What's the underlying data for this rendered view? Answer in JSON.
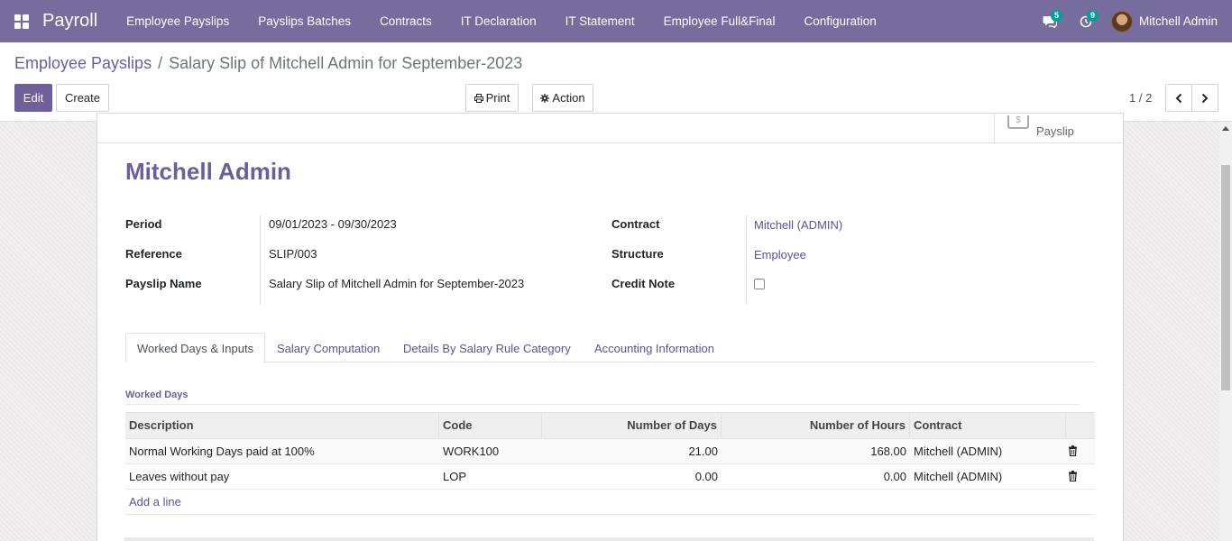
{
  "app": {
    "name": "Payroll",
    "menu": [
      "Employee Payslips",
      "Payslips Batches",
      "Contracts",
      "IT Declaration",
      "IT Statement",
      "Employee Full&Final",
      "Configuration"
    ],
    "messages_count": "5",
    "activities_count": "9",
    "user_name": "Mitchell Admin"
  },
  "breadcrumb": {
    "parent": "Employee Payslips",
    "separator": "/",
    "current": "Salary Slip of Mitchell Admin for September-2023"
  },
  "toolbar": {
    "edit_label": "Edit",
    "create_label": "Create",
    "print_label": "Print",
    "action_label": "Action",
    "pager": "1 / 2"
  },
  "form": {
    "smart_button_label": "Payslip",
    "employee_name": "Mitchell Admin",
    "fields_left": [
      {
        "label": "Period",
        "value": "09/01/2023 - 09/30/2023"
      },
      {
        "label": "Reference",
        "value": "SLIP/003"
      },
      {
        "label": "Payslip Name",
        "value": "Salary Slip of Mitchell Admin for September-2023"
      }
    ],
    "fields_right": [
      {
        "label": "Contract",
        "value": "Mitchell (ADMIN)"
      },
      {
        "label": "Structure",
        "value": "Employee"
      },
      {
        "label": "Credit Note",
        "value": ""
      }
    ]
  },
  "tabs": [
    "Worked Days & Inputs",
    "Salary Computation",
    "Details By Salary Rule Category",
    "Accounting Information"
  ],
  "worked_days": {
    "section_title": "Worked Days",
    "columns": [
      "Description",
      "Code",
      "Number of Days",
      "Number of Hours",
      "Contract"
    ],
    "rows": [
      {
        "description": "Normal Working Days paid at 100%",
        "code": "WORK100",
        "days": "21.00",
        "hours": "168.00",
        "contract": "Mitchell (ADMIN)"
      },
      {
        "description": "Leaves without pay",
        "code": "LOP",
        "days": "0.00",
        "hours": "0.00",
        "contract": "Mitchell (ADMIN)"
      }
    ],
    "add_line_label": "Add a line"
  },
  "colors": {
    "navbar": "#766c9e",
    "primary": "#6f5f9c",
    "link": "#5e5294",
    "badge": "#00a09d"
  },
  "icons": [
    "apps-grid-icon",
    "chat-icon",
    "clock-icon",
    "print-icon",
    "gear-icon",
    "chevron-left-icon",
    "chevron-right-icon",
    "trash-icon",
    "payslip-icon"
  ]
}
